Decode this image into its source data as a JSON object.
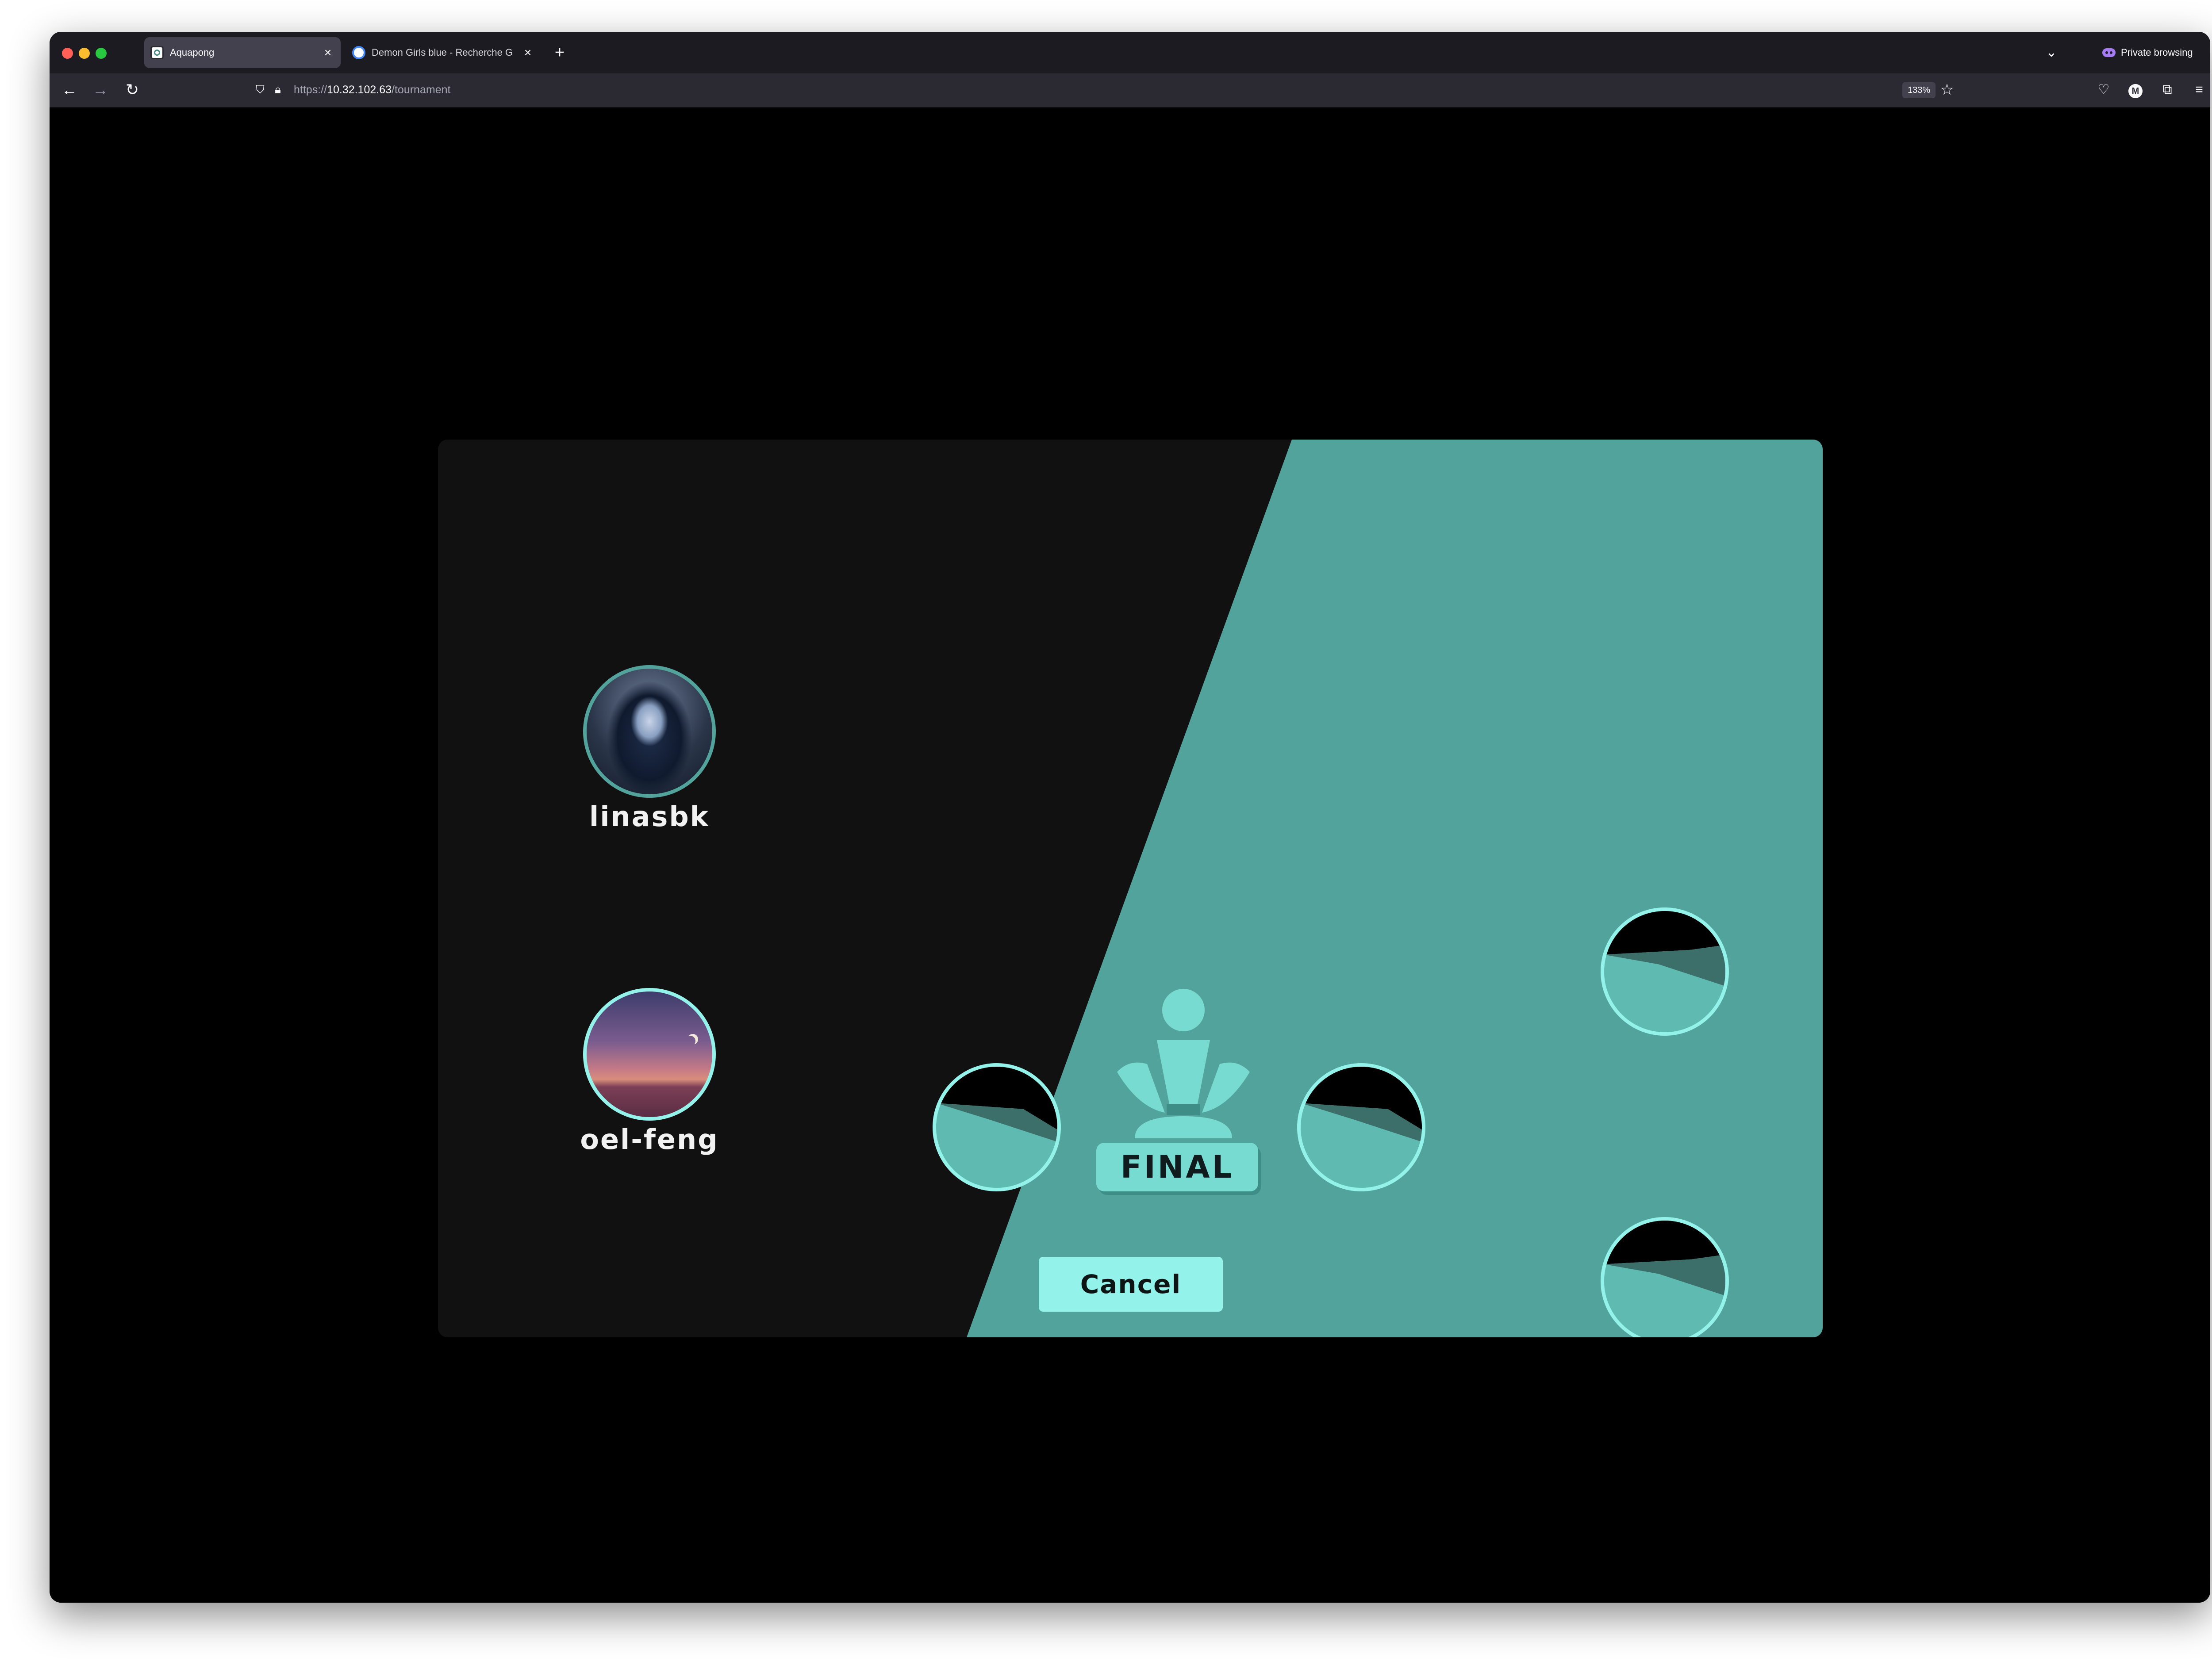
{
  "browser": {
    "tabs": [
      {
        "title": "Aquapong",
        "active": true,
        "favicon": "aquapong-favicon"
      },
      {
        "title": "Demon Girls blue - Recherche G",
        "active": false,
        "favicon": "google-favicon"
      }
    ],
    "private_label": "Private browsing",
    "url": {
      "scheme": "https://",
      "host": "10.32.102.63",
      "path": "/tournament"
    },
    "zoom": "133%"
  },
  "tournament": {
    "players": [
      {
        "name": "linasbk",
        "avatar": "dark-blue-haired-character-avatar"
      },
      {
        "name": "oel-feng",
        "avatar": "sunset-desert-moon-avatar"
      }
    ],
    "final_label": "FINAL",
    "empty_slots": [
      "semi-final-left",
      "semi-final-right",
      "quarter-top",
      "quarter-bottom"
    ],
    "cancel_label": "Cancel"
  },
  "colors": {
    "teal_panel": "#52a39b",
    "accent": "#93f2e9",
    "dark_panel": "#111111"
  }
}
